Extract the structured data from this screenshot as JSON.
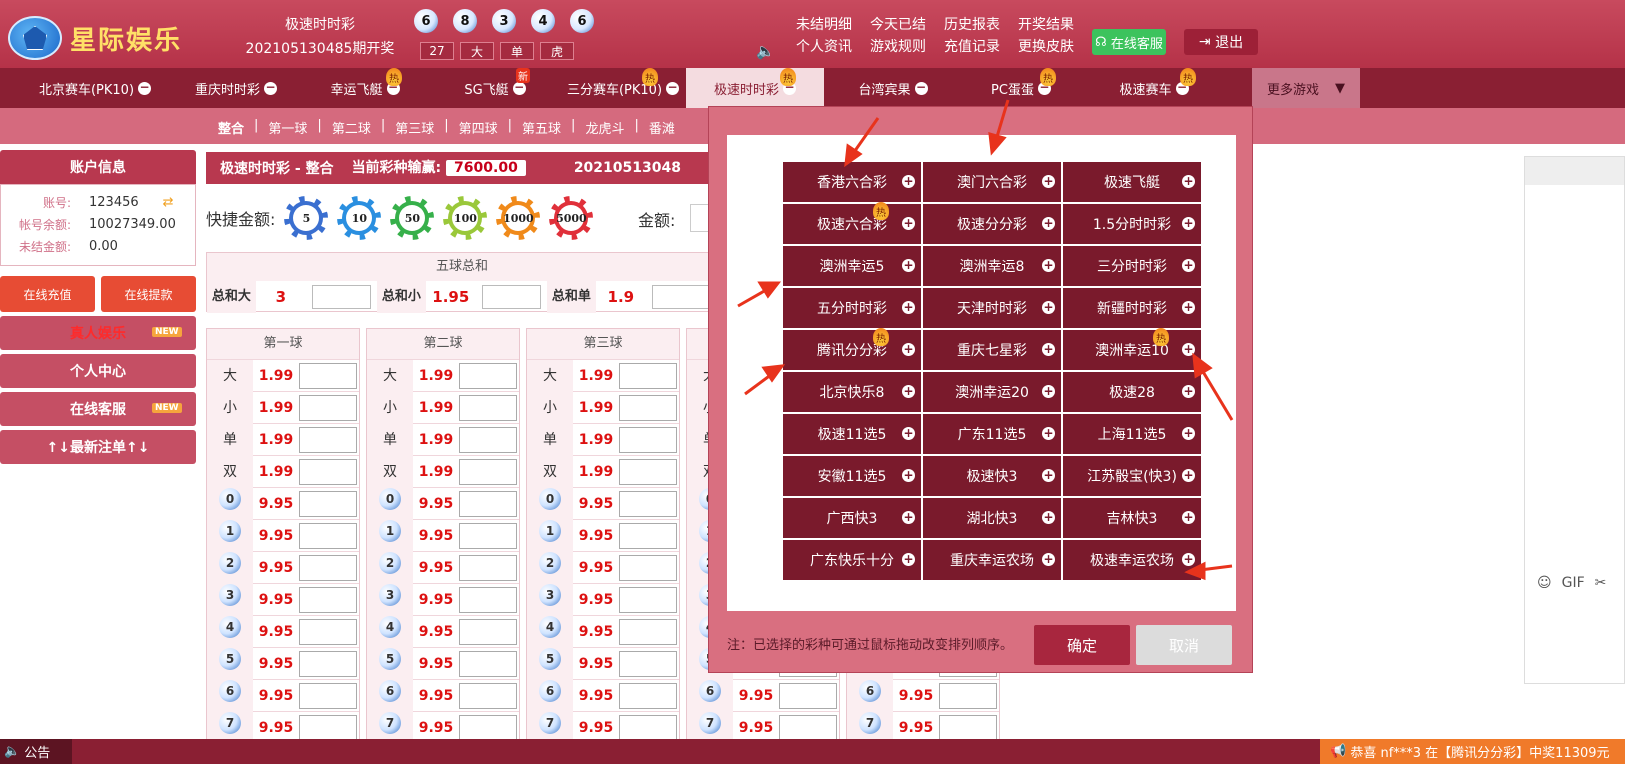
{
  "brand": {
    "logo_text": "星际娱乐"
  },
  "header": {
    "game_name": "极速时时彩",
    "draw_info": "202105130485期开奖",
    "balls": [
      "6",
      "8",
      "3",
      "4",
      "6"
    ],
    "ball_tags": [
      "27",
      "大",
      "单",
      "虎"
    ],
    "links_row1": [
      "未结明细",
      "今天已结",
      "历史报表",
      "开奖结果"
    ],
    "links_row2": [
      "个人资讯",
      "游戏规则",
      "充值记录",
      "更换皮肤"
    ],
    "online_service": "在线客服",
    "logout": "退出"
  },
  "game_nav": {
    "tabs": [
      {
        "label": "北京赛车(PK10)",
        "hot": false,
        "new": false
      },
      {
        "label": "重庆时时彩",
        "hot": false,
        "new": false
      },
      {
        "label": "幸运飞艇",
        "hot": true,
        "new": false
      },
      {
        "label": "SG飞艇",
        "hot": false,
        "new": true
      },
      {
        "label": "三分赛车(PK10)",
        "hot": true,
        "new": false
      },
      {
        "label": "极速时时彩",
        "hot": true,
        "new": false,
        "active": true
      },
      {
        "label": "台湾宾果",
        "hot": false,
        "new": false
      },
      {
        "label": "PC蛋蛋",
        "hot": true,
        "new": false
      },
      {
        "label": "极速赛车",
        "hot": true,
        "new": false
      }
    ],
    "more": "更多游戏",
    "hot_mark": "热",
    "new_mark": "新"
  },
  "sub_nav": [
    "整合",
    "第一球",
    "第二球",
    "第三球",
    "第四球",
    "第五球",
    "龙虎斗",
    "番滩"
  ],
  "account": {
    "title": "账户信息",
    "account_label": "账号:",
    "account_value": "123456",
    "balance_label": "帐号余额:",
    "balance_value": "10027349.00",
    "unsettled_label": "未结金额:",
    "unsettled_value": "0.00",
    "recharge": "在线充值",
    "withdraw": "在线提款",
    "menu": [
      "真人娱乐",
      "个人中心",
      "在线客服",
      "↑↓最新注单↑↓"
    ],
    "new_mark": "NEW"
  },
  "main": {
    "header_game": "极速时时彩",
    "header_sep": "-",
    "header_mode": "整合",
    "payout_label": "当前彩种输赢:",
    "payout_value": "7600.00",
    "period": "20210513048",
    "quick_label": "快捷金额:",
    "chips": [
      "5",
      "10",
      "50",
      "100",
      "1000",
      "5000"
    ],
    "amount_label": "金额:"
  },
  "sum_panel": {
    "title": "五球总和",
    "items": [
      {
        "label": "总和大",
        "odds": "3"
      },
      {
        "label": "总和小",
        "odds": "1.95"
      },
      {
        "label": "总和单",
        "odds": "1.9"
      }
    ]
  },
  "columns": [
    {
      "title": "第一球"
    },
    {
      "title": "第二球"
    },
    {
      "title": "第三球"
    },
    {
      "title": ""
    },
    {
      "title": ""
    }
  ],
  "rows": [
    {
      "label": "大",
      "odds": "1.99"
    },
    {
      "label": "小",
      "odds": "1.99"
    },
    {
      "label": "单",
      "odds": "1.99"
    },
    {
      "label": "双",
      "odds": "1.99"
    },
    {
      "ball": "0",
      "odds": "9.95"
    },
    {
      "ball": "1",
      "odds": "9.95"
    },
    {
      "ball": "2",
      "odds": "9.95"
    },
    {
      "ball": "3",
      "odds": "9.95"
    },
    {
      "ball": "4",
      "odds": "9.95"
    },
    {
      "ball": "5",
      "odds": "9.95"
    },
    {
      "ball": "6",
      "odds": "9.95"
    },
    {
      "ball": "7",
      "odds": "9.95"
    }
  ],
  "modal": {
    "games": [
      {
        "label": "香港六合彩",
        "hot": false
      },
      {
        "label": "澳门六合彩",
        "hot": false
      },
      {
        "label": "极速飞艇",
        "hot": false
      },
      {
        "label": "极速六合彩",
        "hot": true
      },
      {
        "label": "极速分分彩",
        "hot": false
      },
      {
        "label": "1.5分时时彩",
        "hot": false
      },
      {
        "label": "澳洲幸运5",
        "hot": false
      },
      {
        "label": "澳洲幸运8",
        "hot": false
      },
      {
        "label": "三分时时彩",
        "hot": false
      },
      {
        "label": "五分时时彩",
        "hot": false
      },
      {
        "label": "天津时时彩",
        "hot": false
      },
      {
        "label": "新疆时时彩",
        "hot": false
      },
      {
        "label": "腾讯分分彩",
        "hot": true
      },
      {
        "label": "重庆七星彩",
        "hot": false
      },
      {
        "label": "澳洲幸运10",
        "hot": true
      },
      {
        "label": "北京快乐8",
        "hot": false
      },
      {
        "label": "澳洲幸运20",
        "hot": false
      },
      {
        "label": "极速28",
        "hot": false
      },
      {
        "label": "极速11选5",
        "hot": false
      },
      {
        "label": "广东11选5",
        "hot": false
      },
      {
        "label": "上海11选5",
        "hot": false
      },
      {
        "label": "安徽11选5",
        "hot": false
      },
      {
        "label": "极速快3",
        "hot": false
      },
      {
        "label": "江苏骰宝(快3)",
        "hot": false
      },
      {
        "label": "广西快3",
        "hot": false
      },
      {
        "label": "湖北快3",
        "hot": false
      },
      {
        "label": "吉林快3",
        "hot": false
      },
      {
        "label": "广东快乐十分",
        "hot": false
      },
      {
        "label": "重庆幸运农场",
        "hot": false
      },
      {
        "label": "极速幸运农场",
        "hot": false
      }
    ],
    "note": "注：已选择的彩种可通过鼠标拖动改变排列顺序。",
    "confirm": "确定",
    "cancel": "取消"
  },
  "chat": {
    "gif": "GIF"
  },
  "footer": {
    "notice": "公告",
    "winner_text": "恭喜 nf***3 在【腾讯分分彩】中奖11309元"
  },
  "colors": {
    "primary": "#b8384f",
    "nav": "#8a1f33",
    "modal_cell": "#7a1a2c",
    "odds": "#dd1111"
  }
}
